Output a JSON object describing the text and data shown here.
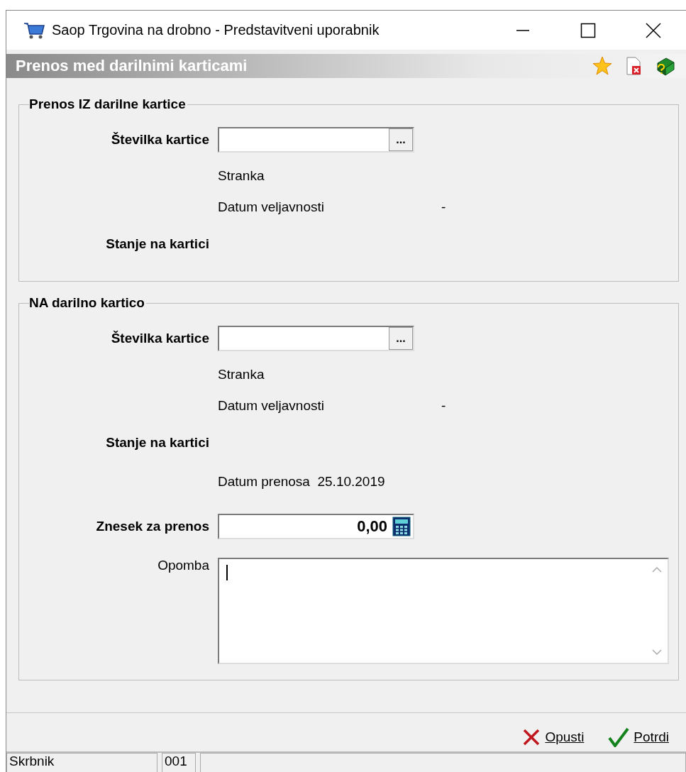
{
  "window": {
    "title": "Saop Trgovina na drobno - Predstavitveni uporabnik"
  },
  "header": {
    "title": "Prenos med darilnimi karticami"
  },
  "sections": [
    {
      "title": "Prenos IZ darilne kartice",
      "rows": [
        {
          "kind": "lookup",
          "label": "Številka kartice",
          "button": "..."
        },
        {
          "kind": "info",
          "label": "Stranka"
        },
        {
          "kind": "info",
          "label": "Datum veljavnosti",
          "value": "-"
        },
        {
          "kind": "heading",
          "label": "Stanje na kartici"
        }
      ]
    },
    {
      "title": "NA darilno kartico",
      "rows": [
        {
          "kind": "lookup",
          "label": "Številka kartice",
          "button": "..."
        },
        {
          "kind": "info",
          "label": "Stranka"
        },
        {
          "kind": "info",
          "label": "Datum veljavnosti",
          "value": "-"
        },
        {
          "kind": "heading",
          "label": "Stanje na kartici"
        },
        {
          "kind": "inline",
          "label": "Datum prenosa",
          "value": "25.10.2019"
        },
        {
          "kind": "amount",
          "label": "Znesek za prenos",
          "value": "0,00"
        },
        {
          "kind": "memo",
          "label": "Opomba"
        }
      ]
    }
  ],
  "buttons": [
    {
      "kind": "cancel",
      "label": "Opusti"
    },
    {
      "kind": "confirm",
      "label": "Potrdi"
    }
  ],
  "status_bar": [
    "Skrbnik",
    "001"
  ]
}
